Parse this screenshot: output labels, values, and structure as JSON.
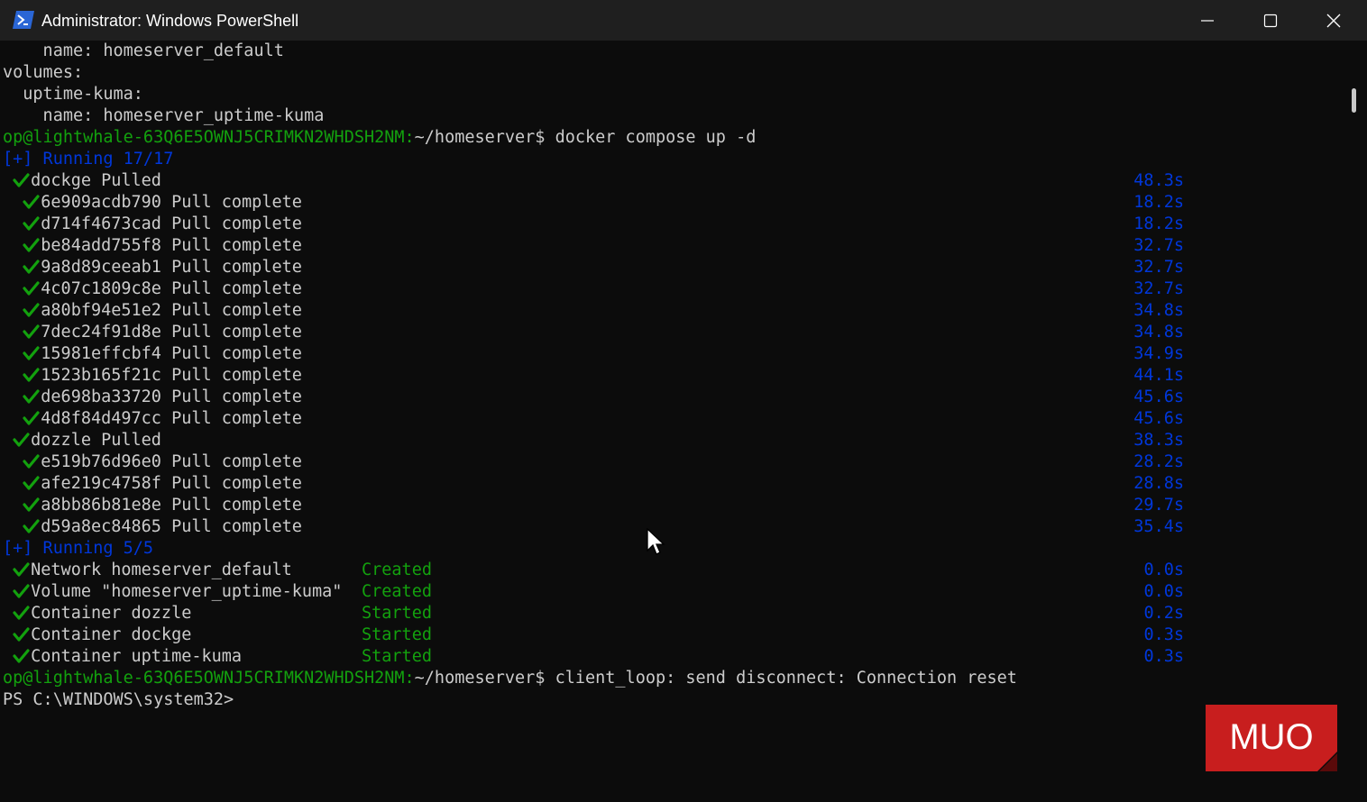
{
  "window": {
    "title": "Administrator: Windows PowerShell",
    "controls": {
      "minimize": "minimize",
      "maximize": "maximize",
      "close": "close"
    }
  },
  "terminal": {
    "pre_lines": [
      "    name: homeserver_default",
      "volumes:",
      "  uptime-kuma:",
      "    name: homeserver_uptime-kuma"
    ],
    "prompt1": {
      "user": "op@lightwhale-63Q6E5OWNJ5CRIMKN2WHDSH2NM:",
      "path": "~/homeserver$",
      "command": " docker compose up -d"
    },
    "running1": "[+] Running 17/17",
    "pull_lines": [
      {
        "indent": 1,
        "text": "dockge Pulled",
        "time": "48.3s"
      },
      {
        "indent": 2,
        "text": "6e909acdb790 Pull complete",
        "time": "18.2s"
      },
      {
        "indent": 2,
        "text": "d714f4673cad Pull complete",
        "time": "18.2s"
      },
      {
        "indent": 2,
        "text": "be84add755f8 Pull complete",
        "time": "32.7s"
      },
      {
        "indent": 2,
        "text": "9a8d89ceeab1 Pull complete",
        "time": "32.7s"
      },
      {
        "indent": 2,
        "text": "4c07c1809c8e Pull complete",
        "time": "32.7s"
      },
      {
        "indent": 2,
        "text": "a80bf94e51e2 Pull complete",
        "time": "34.8s"
      },
      {
        "indent": 2,
        "text": "7dec24f91d8e Pull complete",
        "time": "34.8s"
      },
      {
        "indent": 2,
        "text": "15981effcbf4 Pull complete",
        "time": "34.9s"
      },
      {
        "indent": 2,
        "text": "1523b165f21c Pull complete",
        "time": "44.1s"
      },
      {
        "indent": 2,
        "text": "de698ba33720 Pull complete",
        "time": "45.6s"
      },
      {
        "indent": 2,
        "text": "4d8f84d497cc Pull complete",
        "time": "45.6s"
      },
      {
        "indent": 1,
        "text": "dozzle Pulled",
        "time": "38.3s"
      },
      {
        "indent": 2,
        "text": "e519b76d96e0 Pull complete",
        "time": "28.2s"
      },
      {
        "indent": 2,
        "text": "afe219c4758f Pull complete",
        "time": "28.8s"
      },
      {
        "indent": 2,
        "text": "a8bb86b81e8e Pull complete",
        "time": "29.7s"
      },
      {
        "indent": 2,
        "text": "d59a8ec84865 Pull complete",
        "time": "35.4s"
      }
    ],
    "running2": "[+] Running 5/5",
    "resource_lines": [
      {
        "text": "Network homeserver_default",
        "status": "Created",
        "time": "0.0s"
      },
      {
        "text": "Volume \"homeserver_uptime-kuma\"",
        "status": "Created",
        "time": "0.0s"
      },
      {
        "text": "Container dozzle",
        "status": "Started",
        "time": "0.2s"
      },
      {
        "text": "Container dockge",
        "status": "Started",
        "time": "0.3s"
      },
      {
        "text": "Container uptime-kuma",
        "status": "Started",
        "time": "0.3s"
      }
    ],
    "prompt2": {
      "user": "op@lightwhale-63Q6E5OWNJ5CRIMKN2WHDSH2NM:",
      "path": "~/homeserver$",
      "command": " client_loop: send disconnect: Connection reset"
    },
    "ps_prompt": "PS C:\\WINDOWS\\system32>"
  },
  "watermark": {
    "text": "MUO"
  },
  "colors": {
    "background": "#0c0c0c",
    "titlebar": "#1f1f1f",
    "text": "#cccccc",
    "green": "#13a10e",
    "blue": "#0037da",
    "watermark": "#c81e1e"
  }
}
